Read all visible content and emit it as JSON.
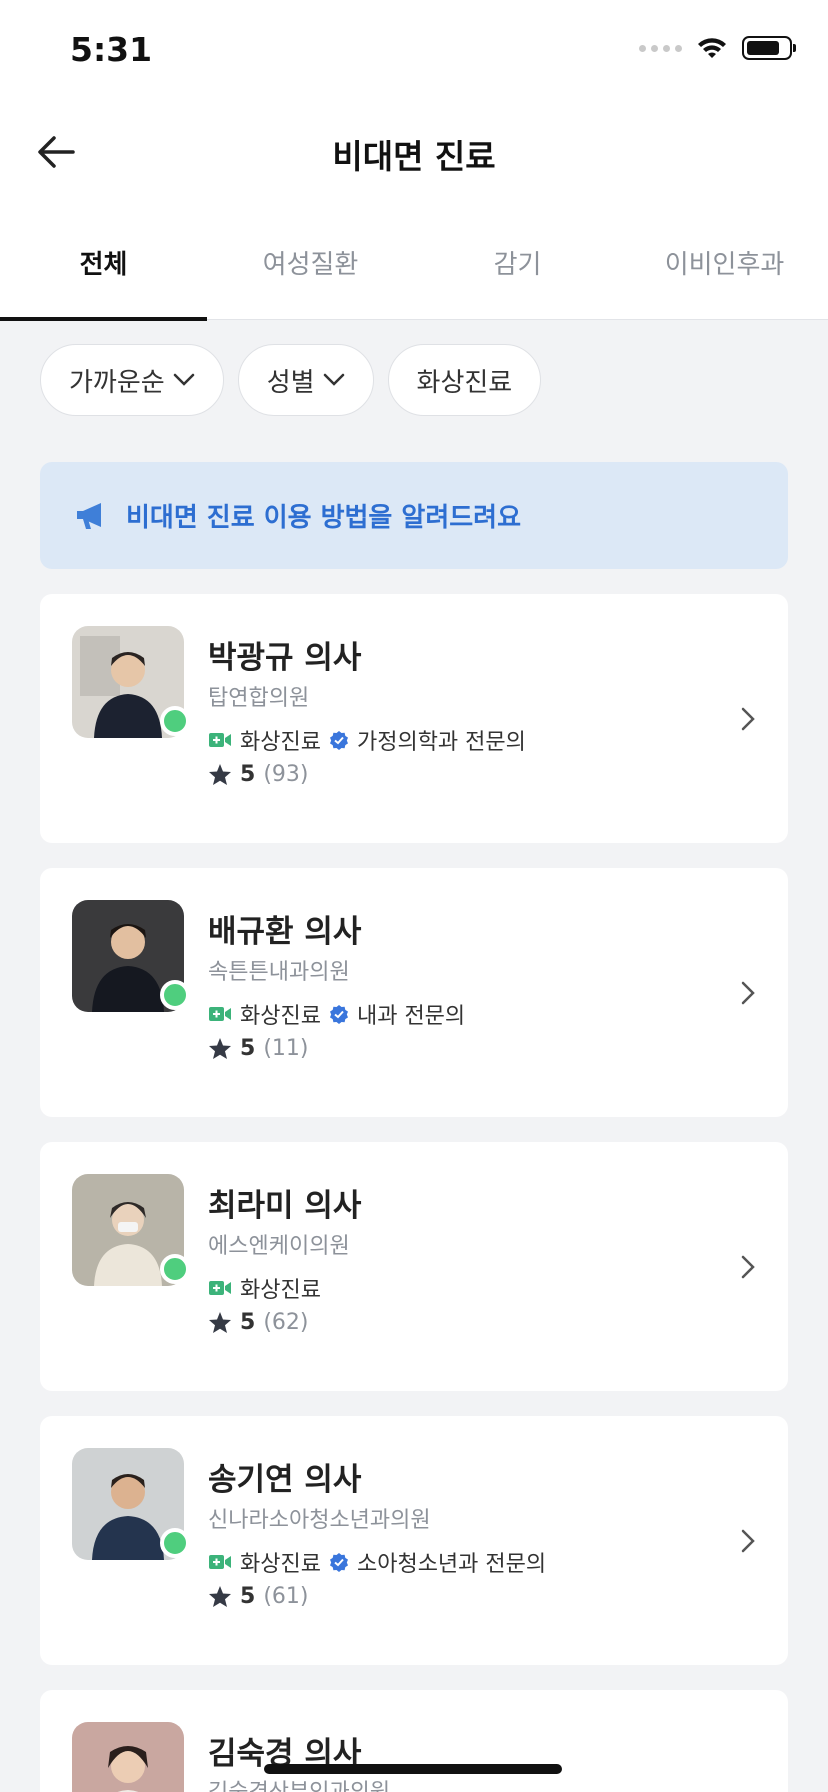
{
  "status": {
    "time": "5:31"
  },
  "nav": {
    "title": "비대면 진료"
  },
  "tabs": [
    "전체",
    "여성질환",
    "감기",
    "이비인후과"
  ],
  "filters": {
    "sort": "가까운순",
    "gender": "성별",
    "video": "화상진료"
  },
  "banner": {
    "text": "비대면 진료 이용 방법을 알려드려요"
  },
  "doctors": [
    {
      "name": "박광규 의사",
      "clinic": "탑연합의원",
      "tag": "화상진료",
      "specialty": "가정의학과 전문의",
      "rating": "5",
      "reviews": "(93)"
    },
    {
      "name": "배규환 의사",
      "clinic": "속튼튼내과의원",
      "tag": "화상진료",
      "specialty": "내과 전문의",
      "rating": "5",
      "reviews": "(11)"
    },
    {
      "name": "최라미 의사",
      "clinic": "에스엔케이의원",
      "tag": "화상진료",
      "specialty": "",
      "rating": "5",
      "reviews": "(62)"
    },
    {
      "name": "송기연 의사",
      "clinic": "신나라소아청소년과의원",
      "tag": "화상진료",
      "specialty": "소아청소년과 전문의",
      "rating": "5",
      "reviews": "(61)"
    },
    {
      "name": "김숙경 의사",
      "clinic": "김숙경산부인과의원"
    }
  ],
  "colors": {
    "accent": "#2d6ed1",
    "online": "#4fce7e",
    "video_tag": "#3cb37a"
  }
}
